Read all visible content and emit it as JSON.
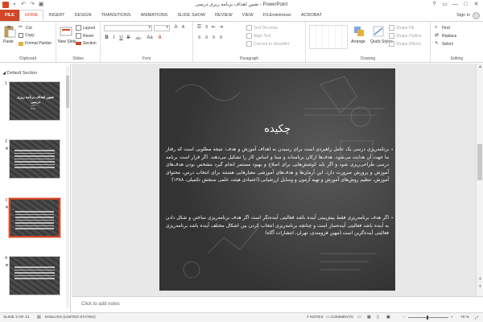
{
  "titlebar": {
    "title": "تعیین اهداف برنامه ریزی درسی - PowerPoint",
    "quick_access": [
      "save-icon",
      "undo-icon",
      "redo-icon",
      "start-presentation-icon"
    ],
    "window_buttons": [
      "?",
      "▭",
      "—",
      "□",
      "✕"
    ]
  },
  "tabs": {
    "file": "FILE",
    "items": [
      "HOME",
      "INSERT",
      "DESIGN",
      "TRANSITIONS",
      "ANIMATIONS",
      "SLIDE SHOW",
      "REVIEW",
      "VIEW",
      "FILEminimizer",
      "ACROBAT"
    ],
    "active": "HOME",
    "sign_in": "Sign in"
  },
  "ribbon": {
    "clipboard": {
      "label": "Clipboard",
      "paste": "Paste",
      "cut": "Cut",
      "copy": "Copy",
      "format_painter": "Format Painter"
    },
    "slides": {
      "label": "Slides",
      "new_slide": "New Slide",
      "layout": "Layout",
      "reset": "Reset",
      "section": "Section"
    },
    "font": {
      "label": "Font",
      "bold": "B",
      "italic": "I",
      "underline": "U",
      "strike": "S",
      "abc": "abc",
      "aa": "Aa"
    },
    "paragraph": {
      "label": "Paragraph",
      "text_direction": "Text Direction",
      "align_text": "Align Text",
      "convert_smartart": "Convert to SmartArt"
    },
    "drawing": {
      "label": "Drawing",
      "arrange": "Arrange",
      "quick_styles": "Quick Styles",
      "shape_fill": "Shape Fill",
      "shape_outline": "Shape Outline",
      "shape_effects": "Shape Effects"
    },
    "editing": {
      "label": "Editing",
      "find": "Find",
      "replace": "Replace",
      "select": "Select"
    }
  },
  "thumbnails": {
    "section": "Default Section",
    "slides": [
      {
        "number": "1",
        "title": "تعیین اهداف برنامه ریزی درسی",
        "sub": ""
      },
      {
        "number": "2",
        "title": "",
        "sub": ""
      },
      {
        "number": "3",
        "title": "",
        "sub": ""
      },
      {
        "number": "4",
        "title": "",
        "sub": ""
      }
    ],
    "star": "★"
  },
  "slide": {
    "title": "چکیده",
    "paragraph1": "برنامه‌ریزی درسی یک عامل راهبردی است برای رسیدن به اهداف آموزش و هدف: نتیجه مطلوبی است که رفتار ما جهت آن هدایت می‌شود. هدف‌ها ارکان برنامه‌اند و مبنا و اساس کار را تشکیل می‌دهند. اگر قرار است برنامه درسی طراحی‌ریزی شود و اگر باید کوشش‌هایی برای اصلاح و بهبود مستمر انجام گیرد مشخص بودن هدف‌های آموزش و پرورش ضرورت دارد. این آرمان‌ها و هدف‌های آموزشی معیارهایی هستند برای انتخاب درس، محتوای آموزش، تنظیم روش‌های آموزش و تهیه آزمون و وسایل ارزشیابی.(اعتمادی هیئت علمی سنجش تکمیلی، ۱۳۸۸)",
    "paragraph2": "اگر هدف برنامه‌ریزی فقط پیش‌بینی آینده باشد فعالیتی آینده‌نگر است اگر هدف برنامه‌ریزی ساختن و شکل دادن به آینده باشد فعالیتی آینده‌ساز است و چنانچه برنامه‌ریزی انتخاب کردن بین اشکال مختلف آینده باشد برنامه‌ریزی فعالیتی آینده‌گزین است.(مهین فرومندی، تهران، انتشارات آگاه)"
  },
  "notes": {
    "placeholder": "Click to add notes"
  },
  "status": {
    "slide_of": "SLIDE 3 OF 21",
    "language": "ENGLISH (UNITED STATES)",
    "notes": "NOTES",
    "comments": "COMMENTS",
    "zoom": "70 %"
  }
}
